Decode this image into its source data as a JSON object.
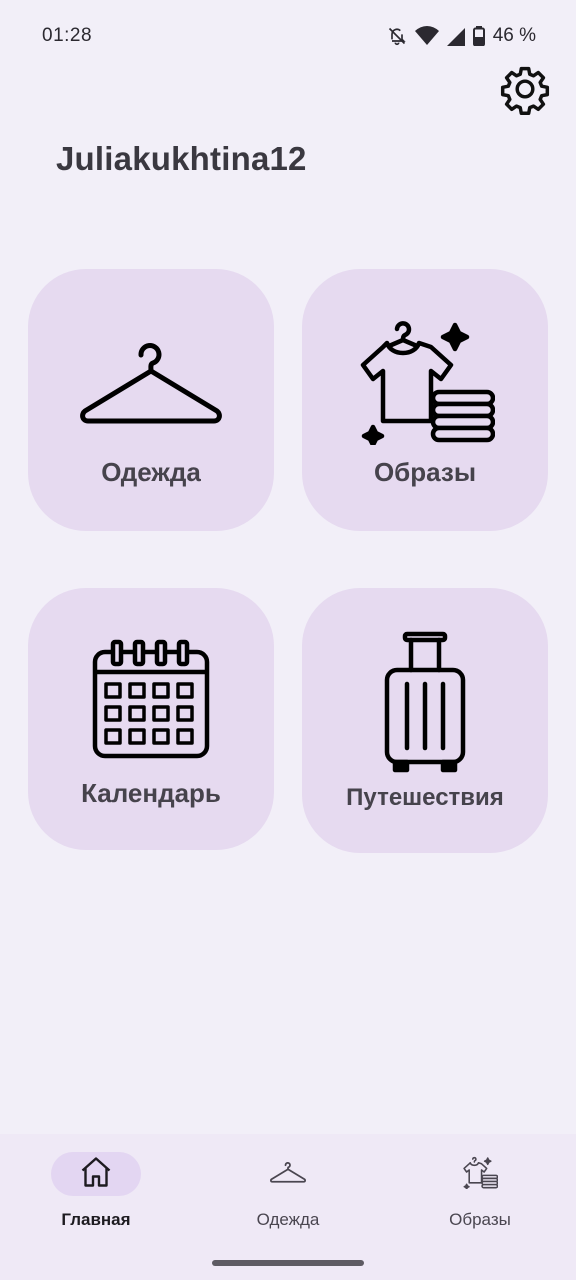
{
  "status_bar": {
    "time": "01:28",
    "battery": "46 %",
    "icons": [
      "mute-icon",
      "wifi-icon",
      "cell-signal-icon",
      "battery-icon"
    ]
  },
  "header": {
    "username": "Juliakukhtina12",
    "settings_icon": "gear-icon"
  },
  "tiles": [
    {
      "label": "Одежда",
      "icon": "hanger-icon"
    },
    {
      "label": "Образы",
      "icon": "outfit-icon"
    },
    {
      "label": "Календарь",
      "icon": "calendar-icon"
    },
    {
      "label": "Путешествия",
      "icon": "suitcase-icon"
    }
  ],
  "bottom_nav": {
    "items": [
      {
        "label": "Главная",
        "icon": "home-icon",
        "active": true
      },
      {
        "label": "Одежда",
        "icon": "hanger-icon",
        "active": false
      },
      {
        "label": "Образы",
        "icon": "outfit-icon",
        "active": false
      }
    ]
  },
  "colors": {
    "background": "#f2eff8",
    "tile": "#e6daf0",
    "nav_background": "#efe9f6",
    "nav_active_pill": "#e3d6f2",
    "text": "#3a3840"
  }
}
